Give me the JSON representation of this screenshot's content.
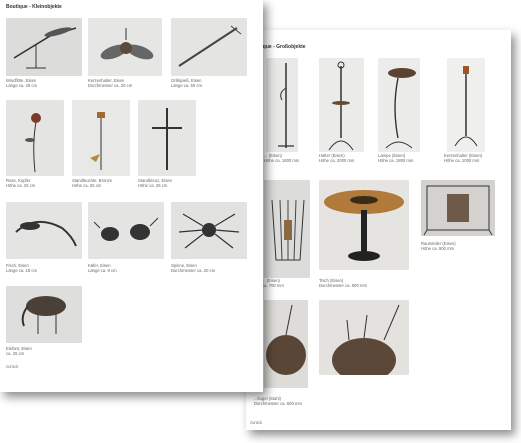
{
  "front": {
    "title": "Boutique - Kleinobjekte",
    "items": [
      {
        "line1": "Windflöte, Eisen",
        "line2": "Länge ca. 28 cm"
      },
      {
        "line1": "Kerzenhalter, Eisen",
        "line2": "Durchmesser ca. 20 cm"
      },
      {
        "line1": "Grillspieß, Eisen",
        "line2": "Länge ca. 50 cm"
      },
      {
        "line1": "Rose, Kupfer",
        "line2": "Höhe ca. 25 cm"
      },
      {
        "line1": "Standleuchte, Bronze",
        "line2": "Höhe ca. 25 cm"
      },
      {
        "line1": "Standkreuz, Eisen",
        "line2": "Höhe ca. 25 cm"
      },
      {
        "line1": "Fisch, Eisen",
        "line2": "Länge ca. 18 cm"
      },
      {
        "line1": "Käfer, Eisen",
        "line2": "Länge ca. 9 cm"
      },
      {
        "line1": "Spinne, Eisen",
        "line2": "Durchmesser ca. 20 cm"
      },
      {
        "line1": "Elefant, Eisen",
        "line2": "ca. 25 cm"
      }
    ],
    "back_link": "zurück"
  },
  "back": {
    "title": "Boutique - Großobjekte",
    "items": [
      {
        "line1": "... (Eisen)",
        "line2": "Höhe ca. 1800 mm"
      },
      {
        "line1": "Halter (Eisen)",
        "line2": "Höhe ca. 2000 mm"
      },
      {
        "line1": "Lampe (Eisen)",
        "line2": "Höhe ca. 1800 mm"
      },
      {
        "line1": "Kerzenhalter (Eisen)",
        "line2": "Höhe ca. 1000 mm"
      },
      {
        "line1": "... (Eisen)",
        "line2": "ca. 700 mm"
      },
      {
        "line1": "Tisch (Eisen)",
        "line2": "Durchmesser ca. 900 mm"
      },
      {
        "line1": "Raumteiler (Eisen)",
        "line2": "Höhe ca. 900 mm"
      },
      {
        "line1": "...kugel (Stahl)",
        "line2": "Durchmesser ca. 600 mm"
      }
    ],
    "back_link": "zurück"
  }
}
